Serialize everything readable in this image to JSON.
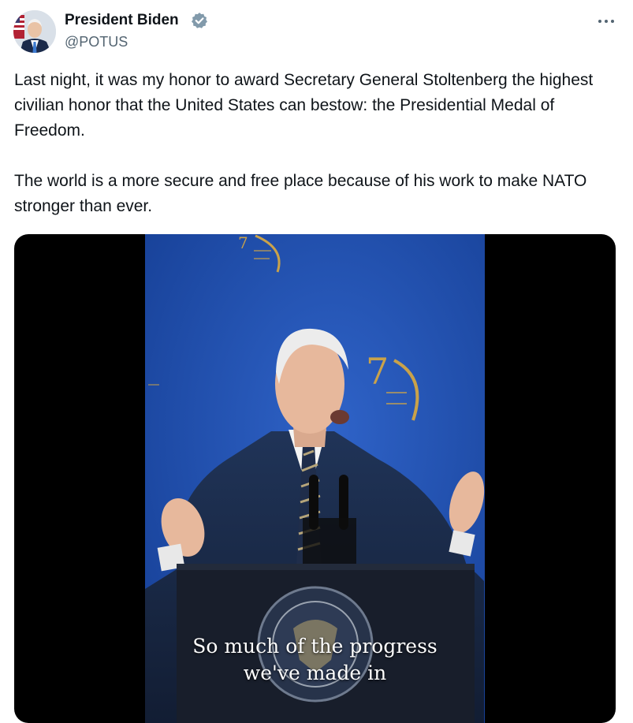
{
  "author": {
    "display_name": "President Biden",
    "handle": "@POTUS",
    "verified": true
  },
  "tweet": {
    "paragraphs": [
      "Last night, it was my honor to award Secretary General Stoltenberg the highest civilian honor that the United States can bestow: the Presidential Medal of Freedom.",
      "The world is a more secure and free place because of his work to make NATO stronger than ever."
    ]
  },
  "media": {
    "type": "video",
    "captions": [
      "So much of the progress",
      "we've made in"
    ]
  },
  "icons": {
    "verified": "verified-badge-icon",
    "more": "more-options-icon"
  },
  "colors": {
    "text": "#0f1419",
    "secondary": "#536471",
    "backdrop_blue": "#1e4fb0",
    "gold": "#c9a24a"
  }
}
